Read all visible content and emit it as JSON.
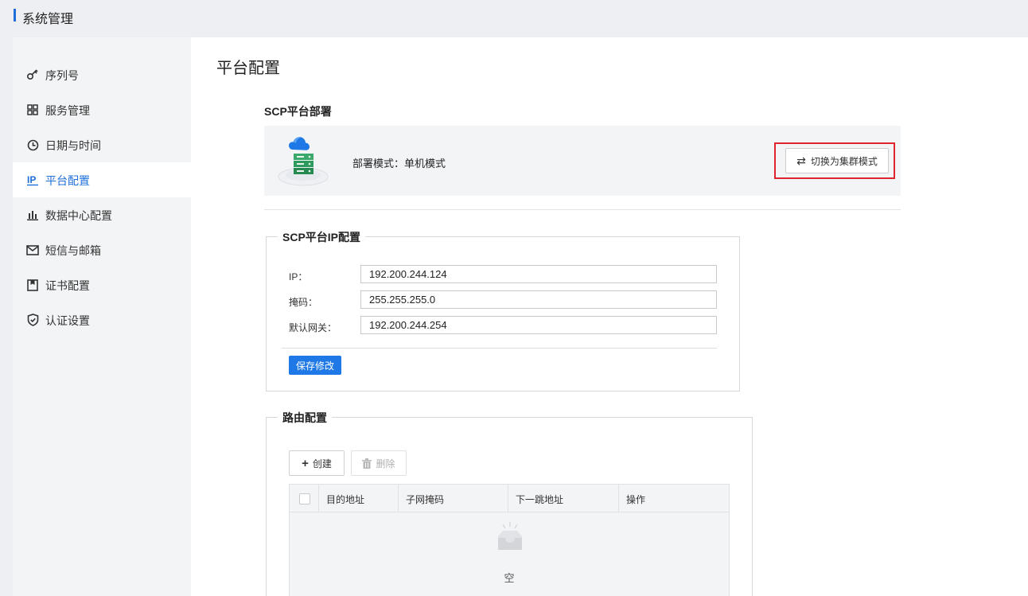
{
  "header": {
    "title": "系统管理"
  },
  "sidebar": {
    "items": [
      {
        "label": "序列号",
        "icon": "key-icon"
      },
      {
        "label": "服务管理",
        "icon": "grid-icon"
      },
      {
        "label": "日期与时间",
        "icon": "clock-icon"
      },
      {
        "label": "平台配置",
        "icon": "ip-icon",
        "active": true
      },
      {
        "label": "数据中心配置",
        "icon": "bar-chart-icon"
      },
      {
        "label": "短信与邮箱",
        "icon": "mail-icon"
      },
      {
        "label": "证书配置",
        "icon": "certificate-icon"
      },
      {
        "label": "认证设置",
        "icon": "shield-icon"
      }
    ]
  },
  "main": {
    "page_title": "平台配置",
    "deploy": {
      "title": "SCP平台部署",
      "mode_text": "部署模式：单机模式",
      "switch_label": "切换为集群模式"
    },
    "ip_config": {
      "legend": "SCP平台IP配置",
      "fields": [
        {
          "label": "IP：",
          "value": "192.200.244.124"
        },
        {
          "label": "掩码：",
          "value": "255.255.255.0"
        },
        {
          "label": "默认网关：",
          "value": "192.200.244.254"
        }
      ],
      "save_label": "保存修改"
    },
    "route_config": {
      "legend": "路由配置",
      "create_label": "创建",
      "delete_label": "删除",
      "columns": [
        "目的地址",
        "子网掩码",
        "下一跳地址",
        "操作"
      ],
      "empty_text": "空"
    }
  },
  "colors": {
    "accent": "#1e6fd9",
    "primary_button": "#1e78e6",
    "highlight_frame": "#e0242f"
  }
}
